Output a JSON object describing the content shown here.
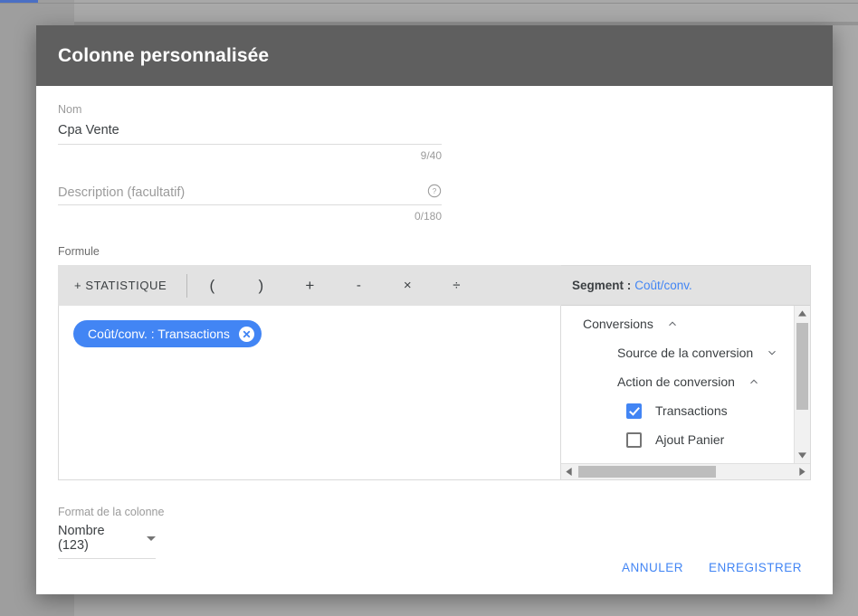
{
  "dialog": {
    "title": "Colonne personnalisée",
    "name_field": {
      "label": "Nom",
      "value": "Cpa Vente",
      "counter": "9/40"
    },
    "description_field": {
      "placeholder": "Description (facultatif)",
      "counter": "0/180",
      "help_icon": "help-circle-icon"
    },
    "formula": {
      "label": "Formule",
      "toolbar": {
        "add_statistic": "+ STATISTIQUE",
        "operators": [
          "(",
          ")",
          "+",
          "-",
          "×",
          "÷"
        ]
      },
      "chips": [
        {
          "label": "Coût/conv. : Transactions",
          "remove_icon": "close-circle-icon"
        }
      ]
    },
    "segment_panel": {
      "header_label": "Segment :",
      "header_value": "Coût/conv.",
      "tree": [
        {
          "label": "Conversions",
          "level": 0,
          "type": "group",
          "caret": "chevron-up-icon"
        },
        {
          "label": "Source de la conversion",
          "level": 1,
          "type": "group",
          "caret": "chevron-down-icon"
        },
        {
          "label": "Action de conversion",
          "level": 1,
          "type": "group",
          "caret": "chevron-up-icon"
        },
        {
          "label": "Transactions",
          "level": 2,
          "type": "checkbox",
          "checked": true
        },
        {
          "label": "Ajout Panier",
          "level": 2,
          "type": "checkbox",
          "checked": false
        }
      ]
    },
    "format": {
      "label": "Format de la colonne",
      "value": "Nombre (123)"
    },
    "actions": {
      "cancel": "ANNULER",
      "save": "ENREGISTRER"
    }
  },
  "colors": {
    "accent": "#4285f4",
    "header_bg": "#5f5f5f",
    "toolbar_bg": "#e2e2e2"
  }
}
